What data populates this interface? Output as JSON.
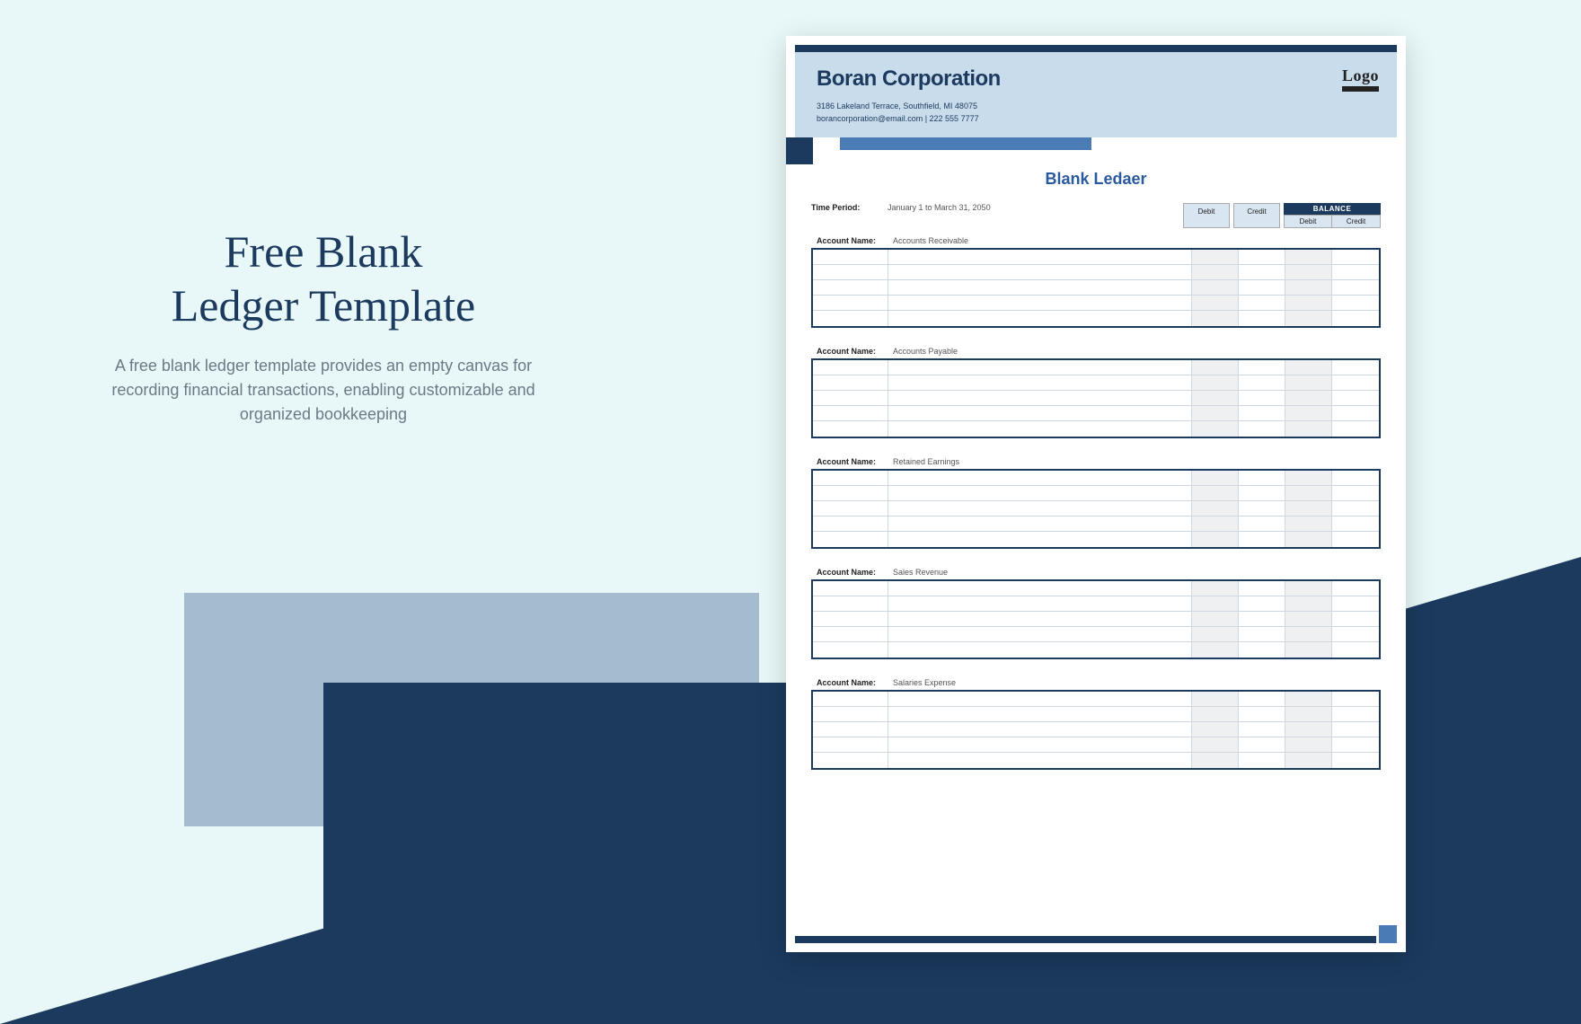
{
  "promo": {
    "title_line1": "Free Blank",
    "title_line2": "Ledger Template",
    "description": "A free blank ledger template provides an empty canvas for recording financial transactions, enabling customizable and organized bookkeeping"
  },
  "document": {
    "company_name": "Boran Corporation",
    "address": "3186 Lakeland Terrace, Southfield, MI 48075",
    "contact": "borancorporation@email.com | 222 555 7777",
    "logo_text": "Logo",
    "title": "Blank Ledaer",
    "time_period_label": "Time Period:",
    "time_period_value": "January 1 to March 31, 2050",
    "columns": {
      "debit": "Debit",
      "credit": "Credit",
      "balance": "BALANCE",
      "balance_debit": "Debit",
      "balance_credit": "Credit"
    },
    "account_name_label": "Account Name:",
    "accounts": [
      "Accounts Receivable",
      "Accounts Payable",
      "Retained Earnings",
      "Sales Revenue",
      "Salaries Expense"
    ]
  }
}
